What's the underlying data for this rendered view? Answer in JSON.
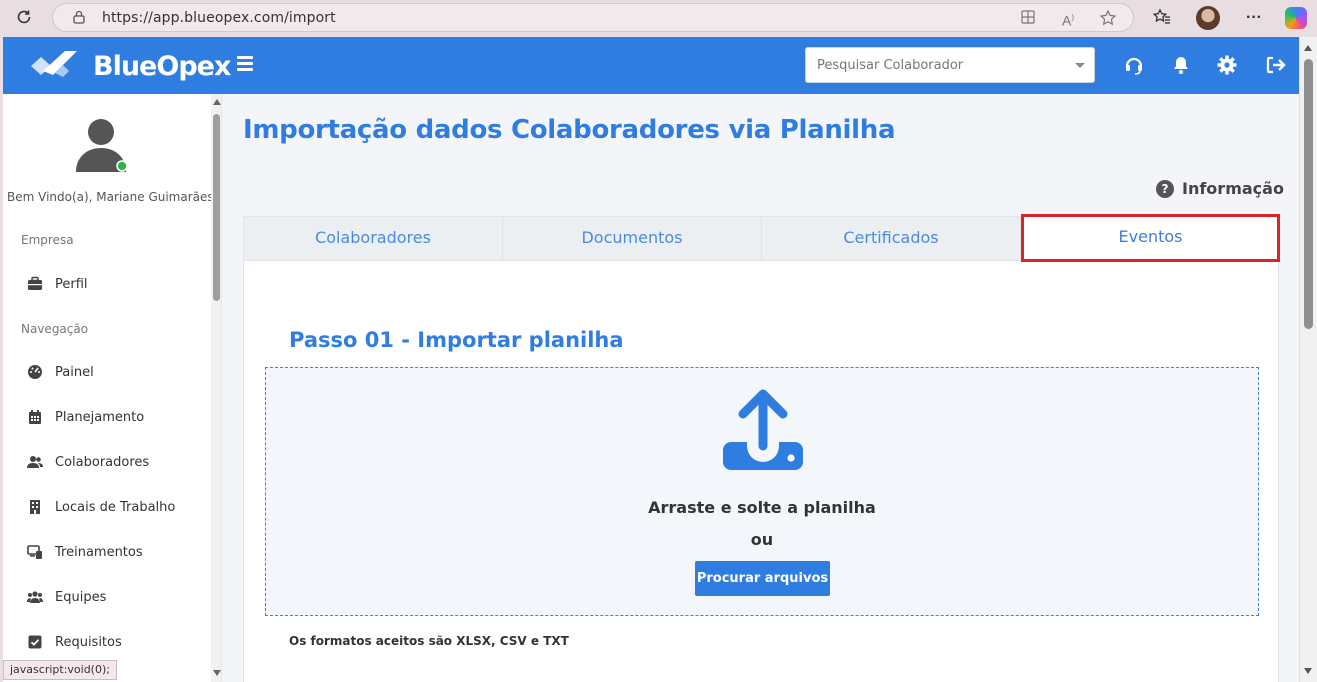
{
  "browser": {
    "url": "https://app.blueopex.com/import",
    "icons": [
      "reload-icon",
      "lock-icon",
      "split-screen-icon",
      "read-aloud-icon",
      "favorite-star-icon",
      "favorites-icon",
      "profile-avatar",
      "more-icon",
      "copilot-icon"
    ],
    "status_text": "javascript:void(0);"
  },
  "header": {
    "brand": "BlueOpex",
    "search_placeholder": "Pesquisar Colaborador",
    "icons": [
      "menu-icon",
      "headset-icon",
      "bell-icon",
      "gear-icon",
      "logout-icon"
    ],
    "accent_color": "#2f7de0"
  },
  "sidebar": {
    "welcome": "Bem Vindo(a), Mariane Guimarães",
    "sections": {
      "empresa": "Empresa",
      "navegacao": "Navegação"
    },
    "items": [
      {
        "label": "Perfil",
        "icon": "briefcase-icon"
      },
      {
        "label": "Painel",
        "icon": "dashboard-icon"
      },
      {
        "label": "Planejamento",
        "icon": "calendar-icon"
      },
      {
        "label": "Colaboradores",
        "icon": "users-icon"
      },
      {
        "label": "Locais de Trabalho",
        "icon": "building-icon"
      },
      {
        "label": "Treinamentos",
        "icon": "training-icon"
      },
      {
        "label": "Equipes",
        "icon": "team-icon"
      },
      {
        "label": "Requisitos",
        "icon": "checkbox-icon"
      }
    ]
  },
  "main": {
    "title": "Importação dados Colaboradores via Planilha",
    "info_link": "Informação",
    "tabs": [
      {
        "label": "Colaboradores",
        "active": false
      },
      {
        "label": "Documentos",
        "active": false
      },
      {
        "label": "Certificados",
        "active": false
      },
      {
        "label": "Eventos",
        "active": true
      }
    ],
    "step1_title": "Passo 01 - Importar planilha",
    "dropzone": {
      "drag_text": "Arraste e solte a planilha",
      "or_text": "ou",
      "button": "Procurar arquivos"
    },
    "formats_note": "Os formatos aceitos são XLSX, CSV e TXT",
    "highlight_color": "#d8262b"
  }
}
